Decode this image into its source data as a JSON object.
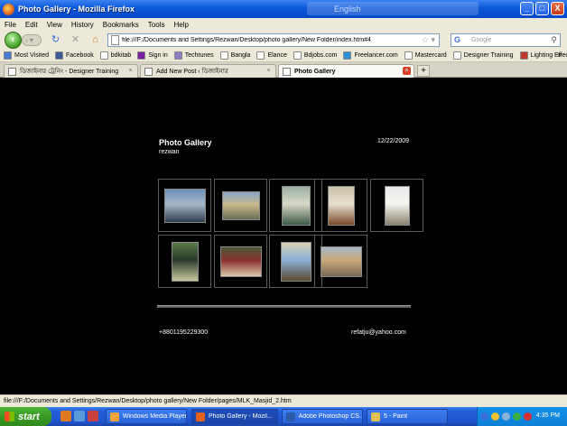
{
  "window": {
    "title": "Photo Gallery - Mozilla Firefox",
    "lang_bar": "English",
    "controls": [
      "_",
      "□",
      "X"
    ]
  },
  "menu": [
    "File",
    "Edit",
    "View",
    "History",
    "Bookmarks",
    "Tools",
    "Help"
  ],
  "nav": {
    "url": "file:///F:/Documents and Settings/Rezwan/Desktop/photo gallery/New Folder/index.htm#4",
    "search_placeholder": "Google"
  },
  "bookmarks": [
    {
      "label": "Most Visited",
      "color": "#4a7bd0"
    },
    {
      "label": "Facebook",
      "color": "#3b5998"
    },
    {
      "label": "bdkitab",
      "color": "#ffffff"
    },
    {
      "label": "Sign in",
      "color": "#7b1fa2"
    },
    {
      "label": "Techtunes",
      "color": "#8e7cc3"
    },
    {
      "label": "Bangla",
      "color": "#ffffff"
    },
    {
      "label": "Elance",
      "color": "#ffffff"
    },
    {
      "label": "Bdjobs.com",
      "color": "#ffffff"
    },
    {
      "label": "Freelancer.com",
      "color": "#2d8fd5"
    },
    {
      "label": "Mastercard",
      "color": "#ffffff"
    },
    {
      "label": "Designer Training",
      "color": "#ffffff"
    },
    {
      "label": "Lighting Effects",
      "color": "#c0392b"
    }
  ],
  "bookmarks_more": "»",
  "tabs": [
    {
      "label": "ডিজাইনার ট্রেনিং - Designer Training",
      "active": false
    },
    {
      "label": "Add New Post ‹ ডিজাইনার",
      "active": false
    },
    {
      "label": "Photo Gallery",
      "active": true
    }
  ],
  "new_tab": "+",
  "gallery": {
    "title": "Photo Gallery",
    "author": "rezwan",
    "date": "12/22/2009",
    "phone": "+8801195229300",
    "email": "refatju@yahoo.com",
    "thumbnails": [
      {
        "name": "thumb-1",
        "colors": [
          "#6a8fb8",
          "#2f3d4d",
          "#a7b8c8"
        ]
      },
      {
        "name": "thumb-2",
        "colors": [
          "#8aa4c8",
          "#6b6e58",
          "#c9b98a"
        ]
      },
      {
        "name": "thumb-3",
        "colors": [
          "#9cb0a0",
          "#3d5a46",
          "#d8d8c8"
        ]
      },
      {
        "name": "thumb-4",
        "colors": [
          "#c9c0a8",
          "#7a4a2a",
          "#e8e0d0"
        ]
      },
      {
        "name": "thumb-5",
        "colors": [
          "#e8e8e8",
          "#8a8270",
          "#f5f5f0"
        ]
      },
      {
        "name": "thumb-6",
        "colors": [
          "#5a7a4a",
          "#c8c8a0",
          "#2a3a2a"
        ]
      },
      {
        "name": "thumb-7",
        "colors": [
          "#4a5a3a",
          "#d8c8a8",
          "#8a3030"
        ]
      },
      {
        "name": "thumb-8",
        "colors": [
          "#d8d0b0",
          "#5a4a30",
          "#8ab0d8"
        ]
      },
      {
        "name": "thumb-9",
        "colors": [
          "#a8b8c8",
          "#7a6a58",
          "#c8a878"
        ]
      }
    ]
  },
  "status": "file:///F:/Documents and Settings/Rezwan/Desktop/photo gallery/New Folder/pages/MLK_Masjid_2.htm",
  "taskbar": {
    "start": "start",
    "tasks": [
      {
        "label": "Windows Media Player",
        "active": false,
        "color": "#f2a33a"
      },
      {
        "label": "Photo Gallery - Mozil...",
        "active": true,
        "color": "#e6621a"
      },
      {
        "label": "Adobe Photoshop CS...",
        "active": false,
        "color": "#2a5aa8"
      },
      {
        "label": "5 - Paint",
        "active": false,
        "color": "#e0c050"
      }
    ],
    "clock": "4:35 PM"
  }
}
